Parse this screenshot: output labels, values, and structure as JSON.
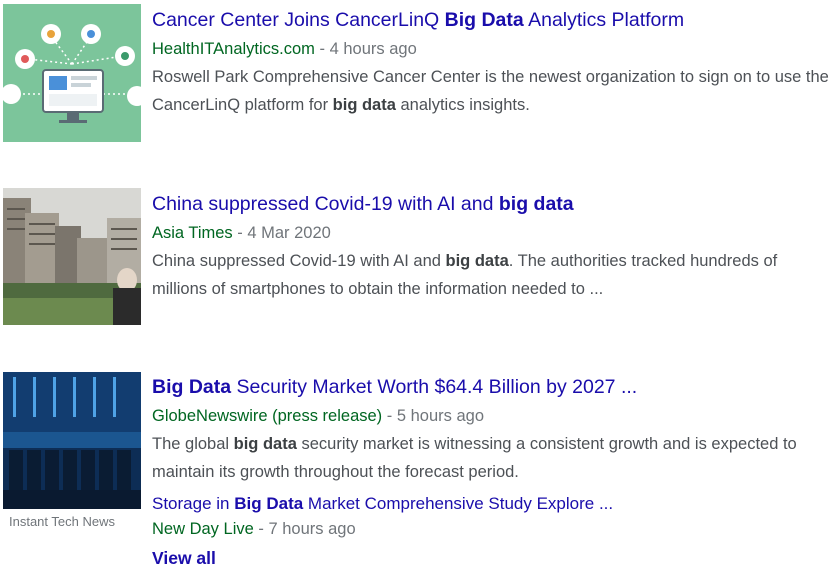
{
  "articles": [
    {
      "title_pre": "Cancer Center Joins CancerLinQ ",
      "title_bold": "Big Data",
      "title_post": " Analytics Platform",
      "source": "HealthITAnalytics.com",
      "separator": " - ",
      "time": "4 hours ago",
      "snippet_pre": "Roswell Park Comprehensive Cancer Center is the newest organization to sign on to use the CancerLinQ platform for ",
      "snippet_bold": "big data",
      "snippet_post": " analytics insights.",
      "thumb_color": "#7cc59b"
    },
    {
      "title_pre": "China suppressed Covid-19 with AI and ",
      "title_bold": "big data",
      "title_post": "",
      "source": "Asia Times",
      "separator": " - ",
      "time": "4 Mar 2020",
      "snippet_pre": "China suppressed Covid-19 with AI and ",
      "snippet_bold": "big data",
      "snippet_post": ". The authorities tracked hundreds of millions of smartphones to obtain the information needed to ...",
      "thumb_color": "#9a958c"
    },
    {
      "title_pre": "",
      "title_bold": "Big Data",
      "title_post": " Security Market Worth $64.4 Billion by 2027 ...",
      "source": "GlobeNewswire (press release)",
      "separator": " - ",
      "time": "5 hours ago",
      "snippet_pre": "The global ",
      "snippet_bold": "big data",
      "snippet_post": " security market is witnessing a consistent growth and is expected to maintain its growth throughout the forecast period.",
      "thumb_color": "#0d2d55",
      "thumb_caption": "Instant Tech News",
      "related": {
        "title_pre": "Storage in ",
        "title_bold": "Big Data",
        "title_post": " Market Comprehensive Study Explore ...",
        "source": "New Day Live",
        "separator": " - ",
        "time": "7 hours ago"
      }
    }
  ],
  "view_all": "View all"
}
